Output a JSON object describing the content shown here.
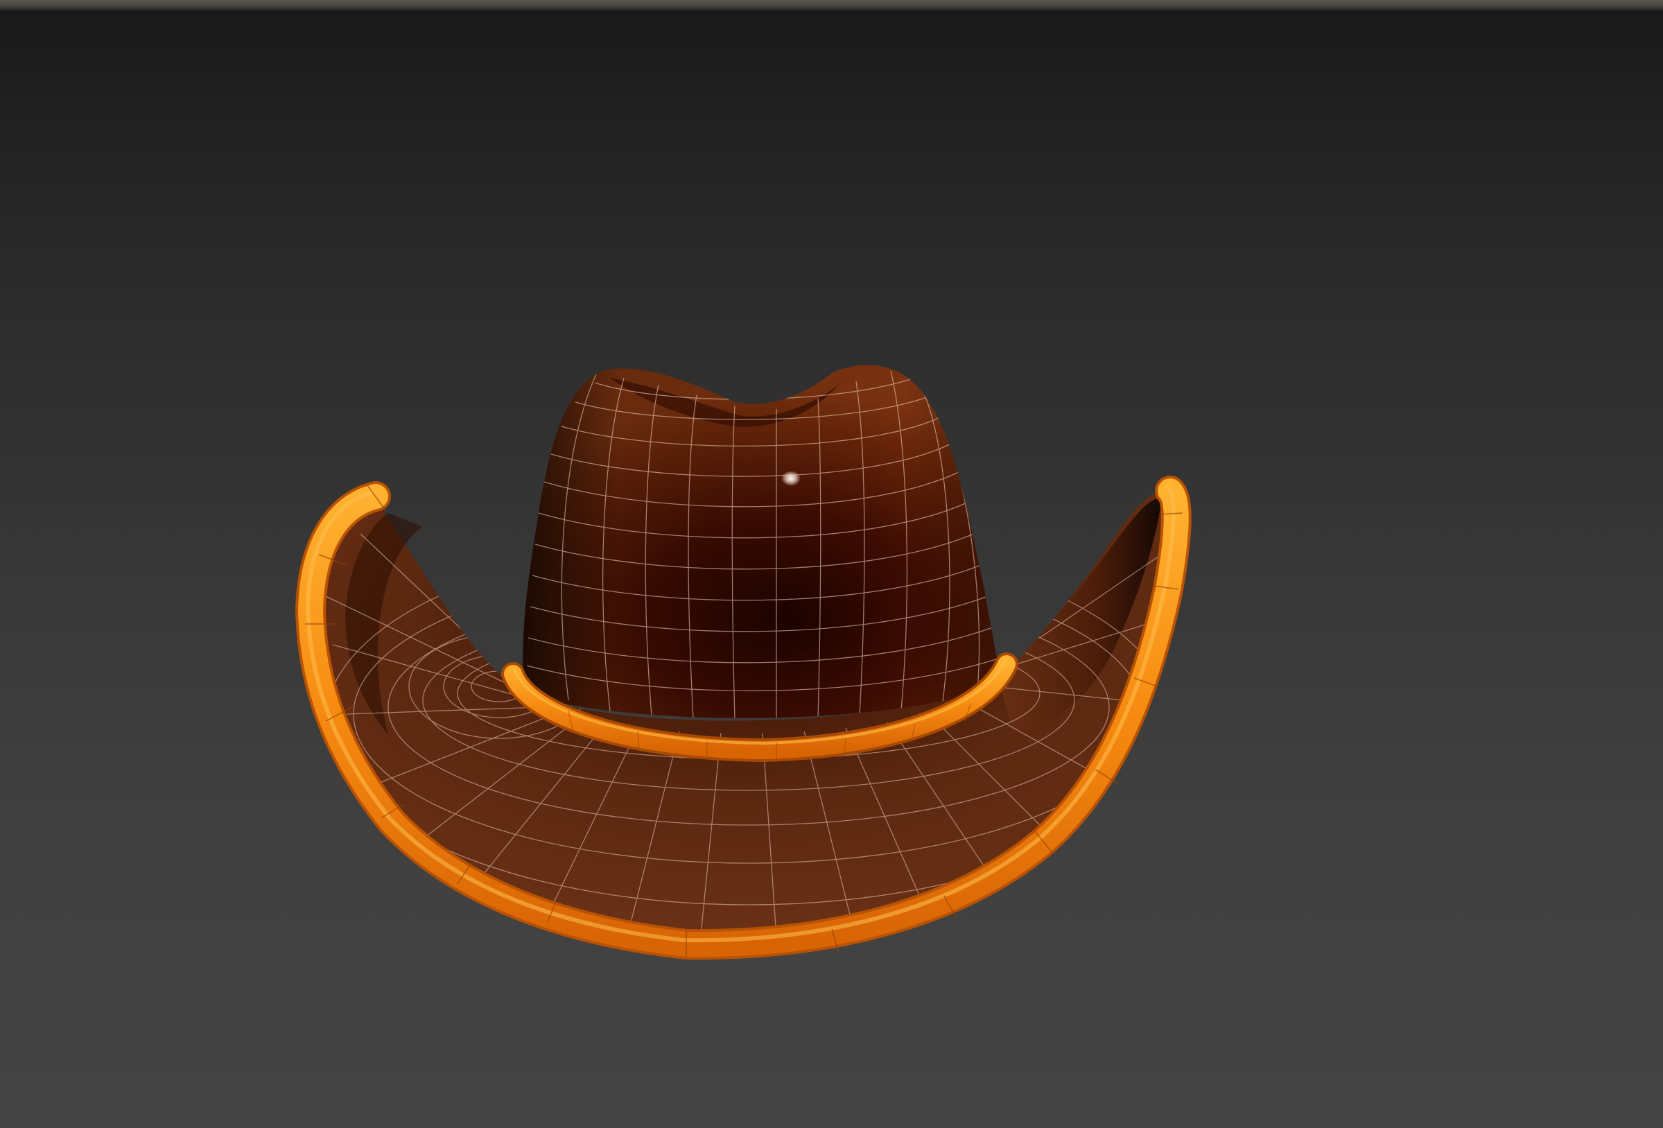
{
  "app": {
    "view": "3d-perspective-viewport"
  },
  "scene": {
    "object": "cowboy-hat",
    "display_mode": "shaded-with-wireframe-edges",
    "colors": {
      "viewport_top": "#191919",
      "viewport_bottom": "#444444",
      "crown": "#4a1505",
      "brim": "#5e2a12",
      "trim": "#f68a10",
      "wire": "#e8c8b4"
    }
  }
}
